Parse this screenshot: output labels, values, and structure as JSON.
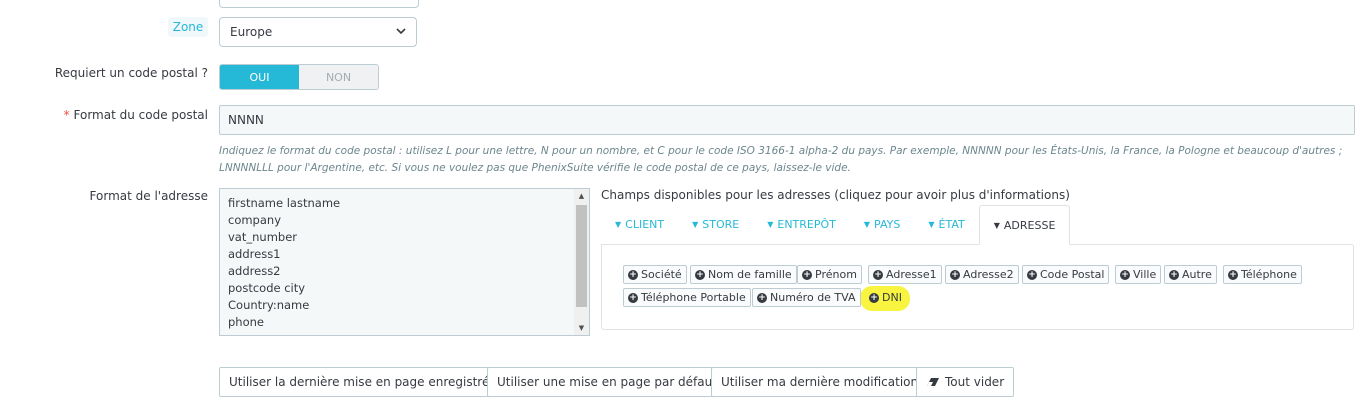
{
  "zone": {
    "label": "Zone",
    "value": "Europe"
  },
  "postcode_required": {
    "label": "Requiert un code postal ?",
    "on": "OUI",
    "off": "NON"
  },
  "postcode_format": {
    "label": "Format du code postal",
    "required_mark": "*",
    "value": "NNNN",
    "help": "Indiquez le format du code postal : utilisez L pour une lettre, N pour un nombre, et C pour le code ISO 3166-1 alpha-2 du pays. Par exemple, NNNNN pour les États-Unis, la France, la Pologne et beaucoup d'autres ; LNNNNLLL pour l'Argentine, etc. Si vous ne voulez pas que PhenixSuite vérifie le code postal de ce pays, laissez-le vide."
  },
  "address_format": {
    "label": "Format de l'adresse",
    "lines": [
      "firstname lastname",
      "company",
      "vat_number",
      "address1",
      "address2",
      "postcode city",
      "Country:name",
      "phone"
    ]
  },
  "available_fields": {
    "title": "Champs disponibles pour les adresses (cliquez pour avoir plus d'informations)",
    "tabs": [
      "CLIENT",
      "STORE",
      "ENTREPÔT",
      "PAYS",
      "ÉTAT",
      "ADRESSE"
    ],
    "active_tab": "ADRESSE",
    "buttons": [
      "Société",
      "Nom de famille",
      "Prénom",
      "Adresse1",
      "Adresse2",
      "Code Postal",
      "Ville",
      "Autre",
      "Téléphone",
      "Téléphone Portable",
      "Numéro de TVA",
      "DNI"
    ]
  },
  "actions": {
    "last_saved": "Utiliser la dernière mise en page enregistrée",
    "default_layout": "Utiliser une mise en page par défaut",
    "last_modification": "Utiliser ma dernière modification",
    "clear_all": "Tout vider"
  },
  "colors": {
    "accent": "#25b9d7",
    "highlight": "#f7f32a",
    "required": "#f54c3e"
  }
}
